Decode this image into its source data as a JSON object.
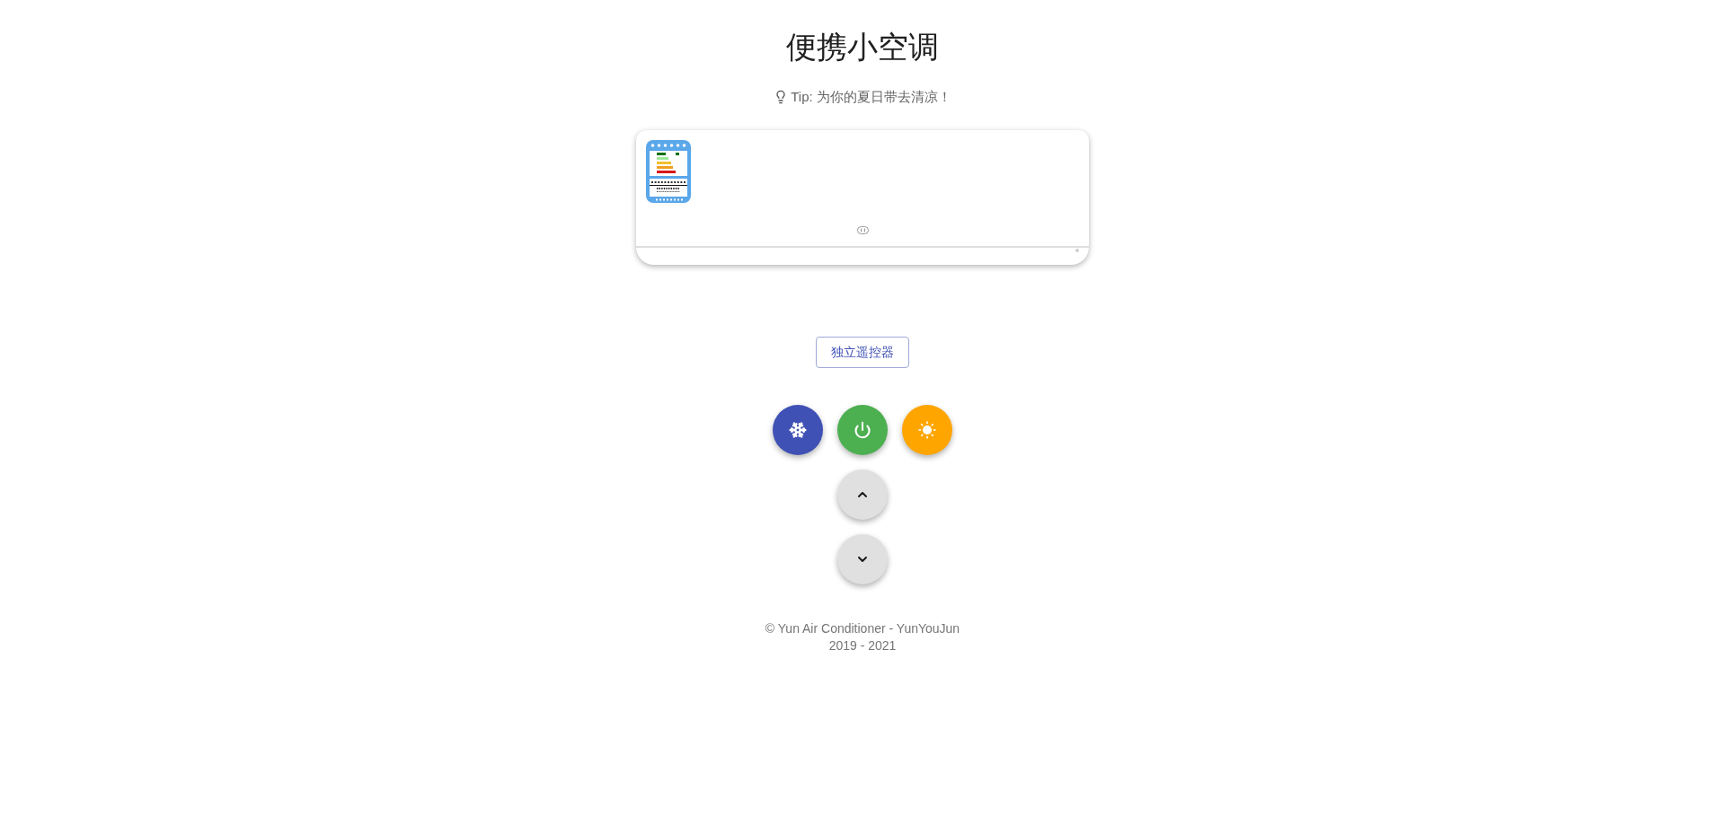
{
  "title": "便携小空调",
  "tip": {
    "text": "Tip: 为你的夏日带去清凉！"
  },
  "remote_button": {
    "label": "独立遥控器"
  },
  "footer": {
    "lines": [
      "© Yun Air Conditioner - YunYouJun",
      "2019 - 2021"
    ]
  }
}
